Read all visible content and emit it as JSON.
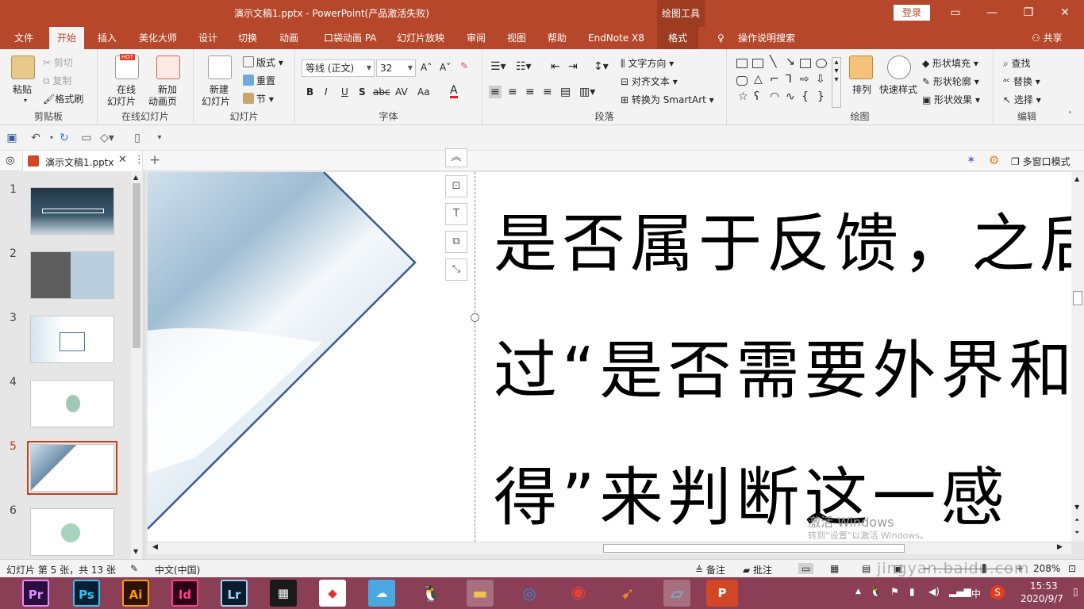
{
  "window": {
    "title": "演示文稿1.pptx  -  PowerPoint(产品激活失败)",
    "context_tools": "绘图工具",
    "login": "登录"
  },
  "tabs": {
    "file": "文件",
    "home": "开始",
    "insert": "插入",
    "meihua": "美化大师",
    "design": "设计",
    "transitions": "切换",
    "animations": "动画",
    "pocket": "口袋动画 PA",
    "slideshow": "幻灯片放映",
    "review": "审阅",
    "view": "视图",
    "help": "帮助",
    "endnote": "EndNote X8",
    "format": "格式",
    "tellme": "操作说明搜索",
    "share": "共享"
  },
  "ribbon": {
    "clipboard": {
      "paste": "粘贴",
      "cut": "剪切",
      "copy": "复制",
      "painter": "格式刷",
      "label": "剪贴板"
    },
    "online": {
      "online_slides_1": "在线",
      "online_slides_2": "幻灯片",
      "new_anim_1": "新加",
      "new_anim_2": "动画页",
      "hot": "HOT",
      "label": "在线幻灯片"
    },
    "slides": {
      "new_1": "新建",
      "new_2": "幻灯片",
      "layout": "版式",
      "reset": "重置",
      "section": "节",
      "label": "幻灯片"
    },
    "font": {
      "name": "等线 (正文)",
      "size": "32",
      "label": "字体",
      "bold": "B",
      "italic": "I",
      "underline": "U",
      "shadow": "S",
      "strike": "abc",
      "spacing": "AV",
      "case": "Aa",
      "color_a": "A"
    },
    "paragraph": {
      "text_dir": "文字方向",
      "align_text": "对齐文本",
      "smartart": "转换为 SmartArt",
      "label": "段落"
    },
    "drawing": {
      "arrange": "排列",
      "quick_styles": "快速样式",
      "fill": "形状填充",
      "outline": "形状轮廓",
      "effects": "形状效果",
      "label": "绘图"
    },
    "editing": {
      "find": "查找",
      "replace": "替换",
      "select": "选择",
      "label": "编辑"
    }
  },
  "doc": {
    "tab_name": "演示文稿1.pptx",
    "multiwindow": "多窗口模式"
  },
  "thumbnails": {
    "numbers": [
      "1",
      "2",
      "3",
      "4",
      "5",
      "6"
    ],
    "selected": 5
  },
  "slide": {
    "lines": [
      "是否属于反馈，之后",
      "过“是否需要外界和",
      "得”来判断这一感"
    ]
  },
  "watermark": {
    "activate": "激活 Windows",
    "goto": "转到“设置”以激活 Windows。",
    "site": "jingyan.baidu.com"
  },
  "statusbar": {
    "slide_info": "幻灯片 第 5 张，共 13 张",
    "language": "中文(中国)",
    "notes": "备注",
    "comments": "批注",
    "zoom": "208%"
  },
  "taskbar": {
    "apps": [
      "Pr",
      "Ps",
      "Ai",
      "Id",
      "Lr"
    ],
    "time": "15:53",
    "date": "2020/9/7",
    "ime": "中"
  },
  "colors": {
    "accent": "#b7472a",
    "selected_thumb": "#c43e1c",
    "taskbar": "#8a3f56"
  }
}
